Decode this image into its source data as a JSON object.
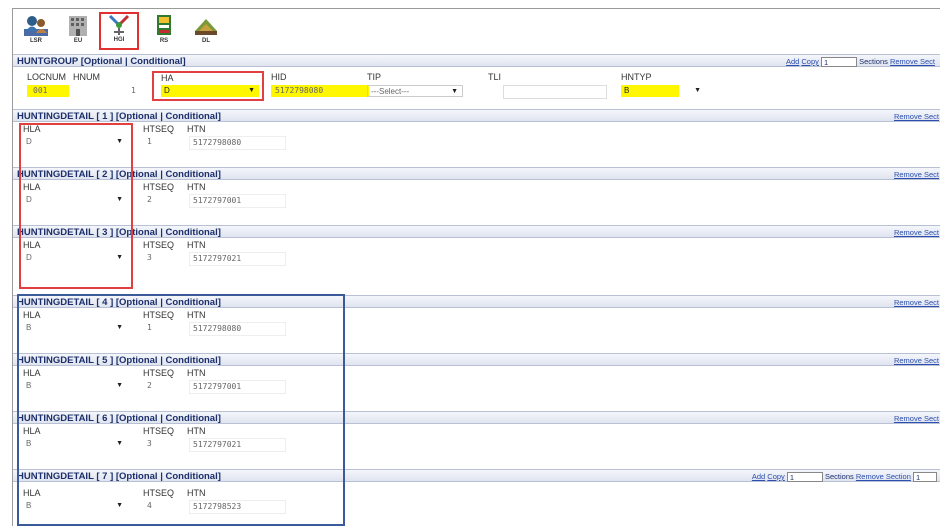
{
  "toolbar": {
    "buttons": [
      {
        "label": "LSR",
        "icon": "lsr-icon"
      },
      {
        "label": "EU",
        "icon": "eu-icon"
      },
      {
        "label": "HGI",
        "icon": "hgi-icon",
        "active": true
      },
      {
        "label": "RS",
        "icon": "rs-icon"
      },
      {
        "label": "DL",
        "icon": "dl-icon"
      }
    ]
  },
  "huntgroup": {
    "title": "HUNTGROUP [Optional | Conditional]",
    "add_label": "Add",
    "copy_label": "Copy",
    "count_value": "1",
    "sections_label": "Sections",
    "remove_label": "Remove Sect",
    "fields": {
      "locnum": {
        "label": "LOCNUM",
        "value": "001"
      },
      "hnum": {
        "label": "HNUM",
        "value": "1"
      },
      "ha": {
        "label": "HA",
        "value": "D"
      },
      "hid": {
        "label": "HID",
        "value": "5172798080"
      },
      "tip": {
        "label": "TIP",
        "value": "---Select---"
      },
      "tli": {
        "label": "TLI",
        "value": ""
      },
      "hntyp": {
        "label": "HNTYP",
        "value": "B"
      }
    }
  },
  "details": [
    {
      "title": "HUNTINGDETAIL [ 1 ] [Optional | Conditional]",
      "hla_label": "HLA",
      "htseq_label": "HTSEQ",
      "htn_label": "HTN",
      "hla": "D",
      "htseq": "1",
      "htn": "5172798080",
      "right": "Remove Sect"
    },
    {
      "title": "HUNTINGDETAIL [ 2 ] [Optional | Conditional]",
      "hla_label": "HLA",
      "htseq_label": "HTSEQ",
      "htn_label": "HTN",
      "hla": "D",
      "htseq": "2",
      "htn": "5172797001",
      "right": "Remove Sect"
    },
    {
      "title": "HUNTINGDETAIL [ 3 ] [Optional | Conditional]",
      "hla_label": "HLA",
      "htseq_label": "HTSEQ",
      "htn_label": "HTN",
      "hla": "D",
      "htseq": "3",
      "htn": "5172797021",
      "right": "Remove Sect"
    },
    {
      "title": "HUNTINGDETAIL [ 4 ] [Optional | Conditional]",
      "hla_label": "HLA",
      "htseq_label": "HTSEQ",
      "htn_label": "HTN",
      "hla": "B",
      "htseq": "1",
      "htn": "5172798080",
      "right": "Remove Sect"
    },
    {
      "title": "HUNTINGDETAIL [ 5 ] [Optional | Conditional]",
      "hla_label": "HLA",
      "htseq_label": "HTSEQ",
      "htn_label": "HTN",
      "hla": "B",
      "htseq": "2",
      "htn": "5172797001",
      "right": "Remove Sect"
    },
    {
      "title": "HUNTINGDETAIL [ 6 ] [Optional | Conditional]",
      "hla_label": "HLA",
      "htseq_label": "HTSEQ",
      "htn_label": "HTN",
      "hla": "B",
      "htseq": "3",
      "htn": "5172797021",
      "right": "Remove Sect"
    },
    {
      "title": "HUNTINGDETAIL [ 7 ] [Optional | Conditional]",
      "hla_label": "HLA",
      "htseq_label": "HTSEQ",
      "htn_label": "HTN",
      "hla": "B",
      "htseq": "4",
      "htn": "5172798523",
      "right": "Remove Section",
      "add": "Add",
      "copy": "Copy",
      "count": "1",
      "sections": "Sections",
      "count2": "1"
    }
  ],
  "colors": {
    "header_text": "#1c2f6b",
    "highlight": "#fff700",
    "annotation_red": "#e24040",
    "annotation_blue": "#3a5a9a"
  }
}
